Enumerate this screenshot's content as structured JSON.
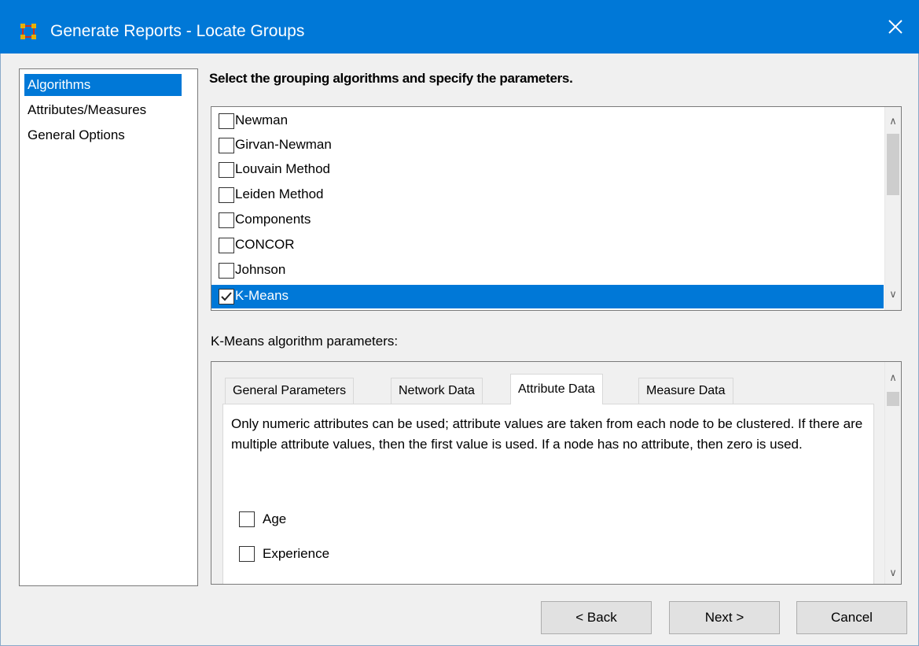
{
  "window": {
    "title": "Generate Reports - Locate Groups"
  },
  "nav": {
    "items": [
      {
        "label": "Algorithms",
        "selected": true
      },
      {
        "label": "Attributes/Measures",
        "selected": false
      },
      {
        "label": "General Options",
        "selected": false
      }
    ]
  },
  "heading": "Select the grouping algorithms and specify the parameters.",
  "algorithms": [
    {
      "label": "Newman",
      "checked": false
    },
    {
      "label": "Girvan-Newman",
      "checked": false
    },
    {
      "label": "Louvain Method",
      "checked": false
    },
    {
      "label": "Leiden Method",
      "checked": false
    },
    {
      "label": "Components",
      "checked": false
    },
    {
      "label": "CONCOR",
      "checked": false
    },
    {
      "label": "Johnson",
      "checked": false
    },
    {
      "label": "K-Means",
      "checked": true,
      "selected": true
    }
  ],
  "params": {
    "label": "K-Means algorithm parameters:",
    "tabs": [
      "General Parameters",
      "Network Data",
      "Attribute Data",
      "Measure Data"
    ],
    "active_tab": "Attribute Data",
    "description": "Only numeric attributes can be used; attribute values are taken from each node to be clustered. If there are multiple attribute values, then the first value is used. If a node has no attribute, then zero is used.",
    "attributes": [
      {
        "label": "Age",
        "checked": false
      },
      {
        "label": "Experience",
        "checked": false
      }
    ]
  },
  "buttons": {
    "back": "< Back",
    "next": "Next >",
    "cancel": "Cancel"
  },
  "colors": {
    "titlebar": "#0078d7",
    "selection": "#0078d7",
    "window_bg": "#f0f0f0"
  }
}
